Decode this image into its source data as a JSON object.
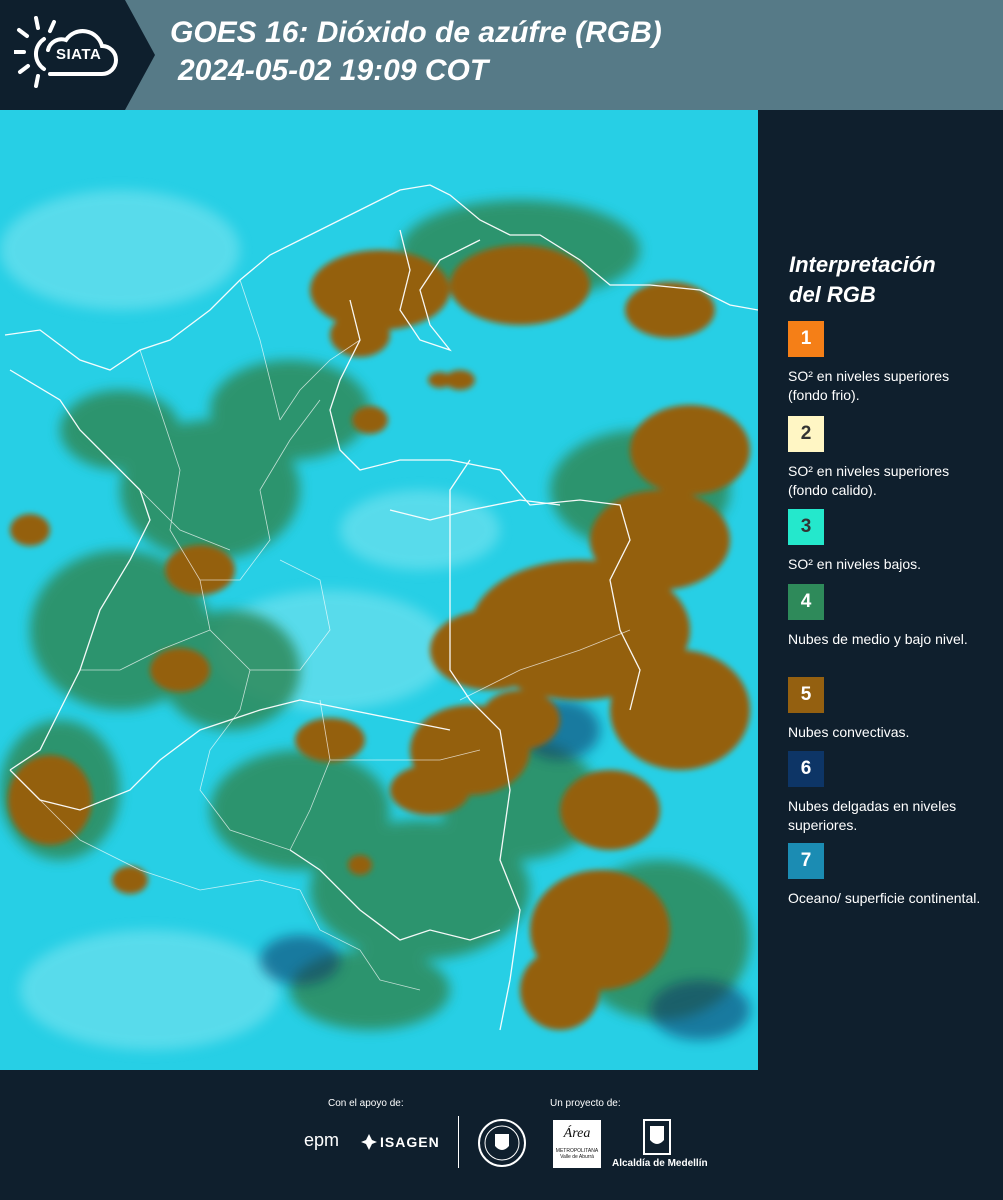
{
  "header": {
    "logo_text": "SIATA",
    "title_line1": "GOES 16: Dióxido de azúfre (RGB)",
    "title_line2": "2024-05-02 19:09 COT"
  },
  "legend": {
    "title_line1": "Interpretación",
    "title_line2": "del RGB",
    "items": [
      {
        "number": "1",
        "color": "#f57f17",
        "text": "SO² en niveles superiores (fondo frio)."
      },
      {
        "number": "2",
        "color": "#fff6c4",
        "text": "SO² en niveles superiores (fondo calido)."
      },
      {
        "number": "3",
        "color": "#24e8cc",
        "text": "SO² en niveles bajos."
      },
      {
        "number": "4",
        "color": "#2e8a5a",
        "text": "Nubes de medio y bajo nivel."
      },
      {
        "number": "5",
        "color": "#946010",
        "text": "Nubes convectivas."
      },
      {
        "number": "6",
        "color": "#0d3566",
        "text": "Nubes delgadas en niveles superiores."
      },
      {
        "number": "7",
        "color": "#1b8cb3",
        "text": "Oceano/ superficie continental."
      }
    ]
  },
  "footer": {
    "support_label": "Con el apoyo de:",
    "project_label": "Un proyecto de:",
    "epm_logo": "epm",
    "isagen_logo": "ISAGEN",
    "area_logo": "Área",
    "area_sub": "METROPOLITANA",
    "area_sub2": "Valle de Aburrá",
    "alcaldia_logo": "Alcaldía de Medellín"
  },
  "colors": {
    "header_bg": "#567a87",
    "panel_bg": "#0f1f2d",
    "ocean": "#27cfe5",
    "cloud_convective": "#946010",
    "cloud_mid": "#2e8a5a"
  }
}
